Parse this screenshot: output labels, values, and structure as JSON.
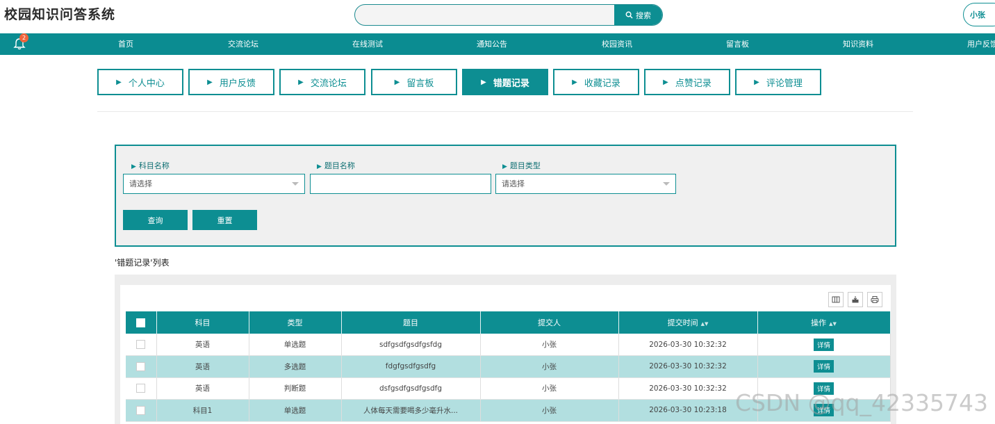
{
  "header": {
    "site_title": "校园知识问答系统",
    "search_placeholder": "",
    "search_label": "搜索",
    "user_label": "小张"
  },
  "nav": {
    "badge": "2",
    "items": [
      "首页",
      "交流论坛",
      "在线测试",
      "通知公告",
      "校园资讯",
      "留言板",
      "知识资料",
      "用户反馈"
    ]
  },
  "tabs": [
    {
      "label": "个人中心",
      "active": false
    },
    {
      "label": "用户反馈",
      "active": false
    },
    {
      "label": "交流论坛",
      "active": false
    },
    {
      "label": "留言板",
      "active": false
    },
    {
      "label": "错题记录",
      "active": true
    },
    {
      "label": "收藏记录",
      "active": false
    },
    {
      "label": "点赞记录",
      "active": false
    },
    {
      "label": "评论管理",
      "active": false
    }
  ],
  "filter": {
    "subject_label": "科目名称",
    "subject_value": "请选择",
    "question_label": "题目名称",
    "question_value": "",
    "type_label": "题目类型",
    "type_value": "请选择",
    "query_btn": "查询",
    "reset_btn": "重置"
  },
  "list_title": "'错题记录'列表",
  "table": {
    "columns": [
      "科目",
      "类型",
      "题目",
      "提交人",
      "提交时间",
      "操作"
    ],
    "detail_label": "详情",
    "rows": [
      {
        "subject": "英语",
        "type": "单选题",
        "question": "sdfgsdfgsdfgsfdg",
        "submitter": "小张",
        "time": "2026-03-30 10:32:32"
      },
      {
        "subject": "英语",
        "type": "多选题",
        "question": "fdgfgsdfgsdfg",
        "submitter": "小张",
        "time": "2026-03-30 10:32:32"
      },
      {
        "subject": "英语",
        "type": "判断题",
        "question": "dsfgsdfgsdfgsdfg",
        "submitter": "小张",
        "time": "2026-03-30 10:32:32"
      },
      {
        "subject": "科目1",
        "type": "单选题",
        "question": "人体每天需要喝多少毫升水...",
        "submitter": "小张",
        "time": "2026-03-30 10:23:18"
      }
    ]
  },
  "watermark": "CSDN @qq_42335743",
  "colors": {
    "accent": "#0d8e92",
    "row_alt": "#b2dfe0"
  }
}
